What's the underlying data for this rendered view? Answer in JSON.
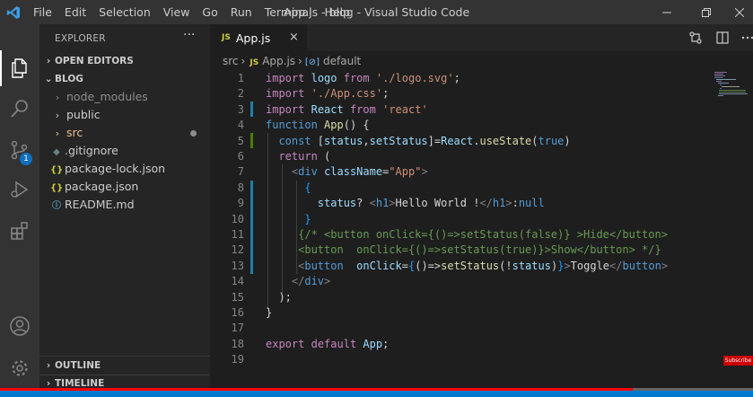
{
  "window": {
    "title": "App.js - blog - Visual Studio Code",
    "menu": [
      "File",
      "Edit",
      "Selection",
      "View",
      "Go",
      "Run",
      "Terminal",
      "Help"
    ]
  },
  "activity_bar": {
    "icons": [
      "explorer-icon",
      "search-icon",
      "source-control-icon",
      "run-debug-icon",
      "extensions-icon",
      "account-icon",
      "manage-gear-icon"
    ],
    "scm_badge": "1"
  },
  "sidebar": {
    "title": "EXPLORER",
    "more": "···",
    "open_editors": "OPEN EDITORS",
    "folder": "BLOG",
    "items": [
      {
        "label": "node_modules",
        "kind": "folder"
      },
      {
        "label": "public",
        "kind": "folder"
      },
      {
        "label": "src",
        "kind": "folder"
      },
      {
        "label": ".gitignore",
        "kind": "file"
      },
      {
        "label": "package-lock.json",
        "kind": "json"
      },
      {
        "label": "package.json",
        "kind": "json"
      },
      {
        "label": "README.md",
        "kind": "info"
      }
    ],
    "outline": "OUTLINE",
    "timeline": "TIMELINE"
  },
  "editor": {
    "tab": {
      "label": "App.js",
      "icon": "JS",
      "close": "×"
    },
    "breadcrumbs": {
      "folder": "src",
      "file": "App.js",
      "symbol": "default",
      "js": "JS",
      "symbol_icon": "[⊘]"
    },
    "line_numbers": [
      "1",
      "2",
      "3",
      "4",
      "5",
      "6",
      "7",
      "8",
      "9",
      "10",
      "11",
      "12",
      "13",
      "14",
      "15",
      "16",
      "17",
      "18",
      "19"
    ]
  },
  "overlay": {
    "subscribe": "Subscribe",
    "progress": 0.84
  },
  "colors": {
    "accent": "#007acc",
    "titlebar": "#333333",
    "sidebar": "#252526",
    "editor": "#1e1e1e",
    "progress": "#ff0000"
  }
}
